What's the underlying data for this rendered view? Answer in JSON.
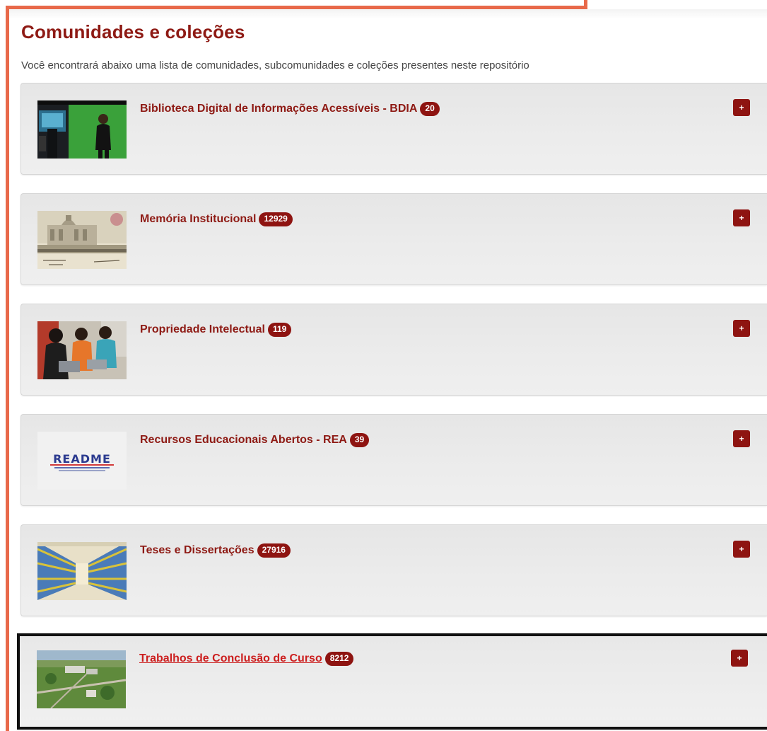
{
  "page": {
    "title": "Comunidades e coleções",
    "subtitle": "Você encontrará abaixo uma lista de comunidades, subcomunidades e coleções presentes neste repositório"
  },
  "communities": [
    {
      "name": "Biblioteca Digital de Informações Acessíveis - BDIA",
      "count": "20",
      "expand_label": "+"
    },
    {
      "name": "Memória Institucional",
      "count": "12929",
      "expand_label": "+"
    },
    {
      "name": "Propriedade Intelectual",
      "count": "119",
      "expand_label": "+"
    },
    {
      "name": "Recursos Educacionais Abertos - REA",
      "count": "39",
      "expand_label": "+"
    },
    {
      "name": "Teses e Dissertações",
      "count": "27916",
      "expand_label": "+"
    },
    {
      "name": "Trabalhos de Conclusão de Curso",
      "count": "8212",
      "expand_label": "+"
    }
  ],
  "colors": {
    "accent": "#8e1a14",
    "active_link": "#cc1f1f",
    "highlight_border": "#e8694a",
    "focus_border": "#111111"
  },
  "thumb_logo_text": "README"
}
